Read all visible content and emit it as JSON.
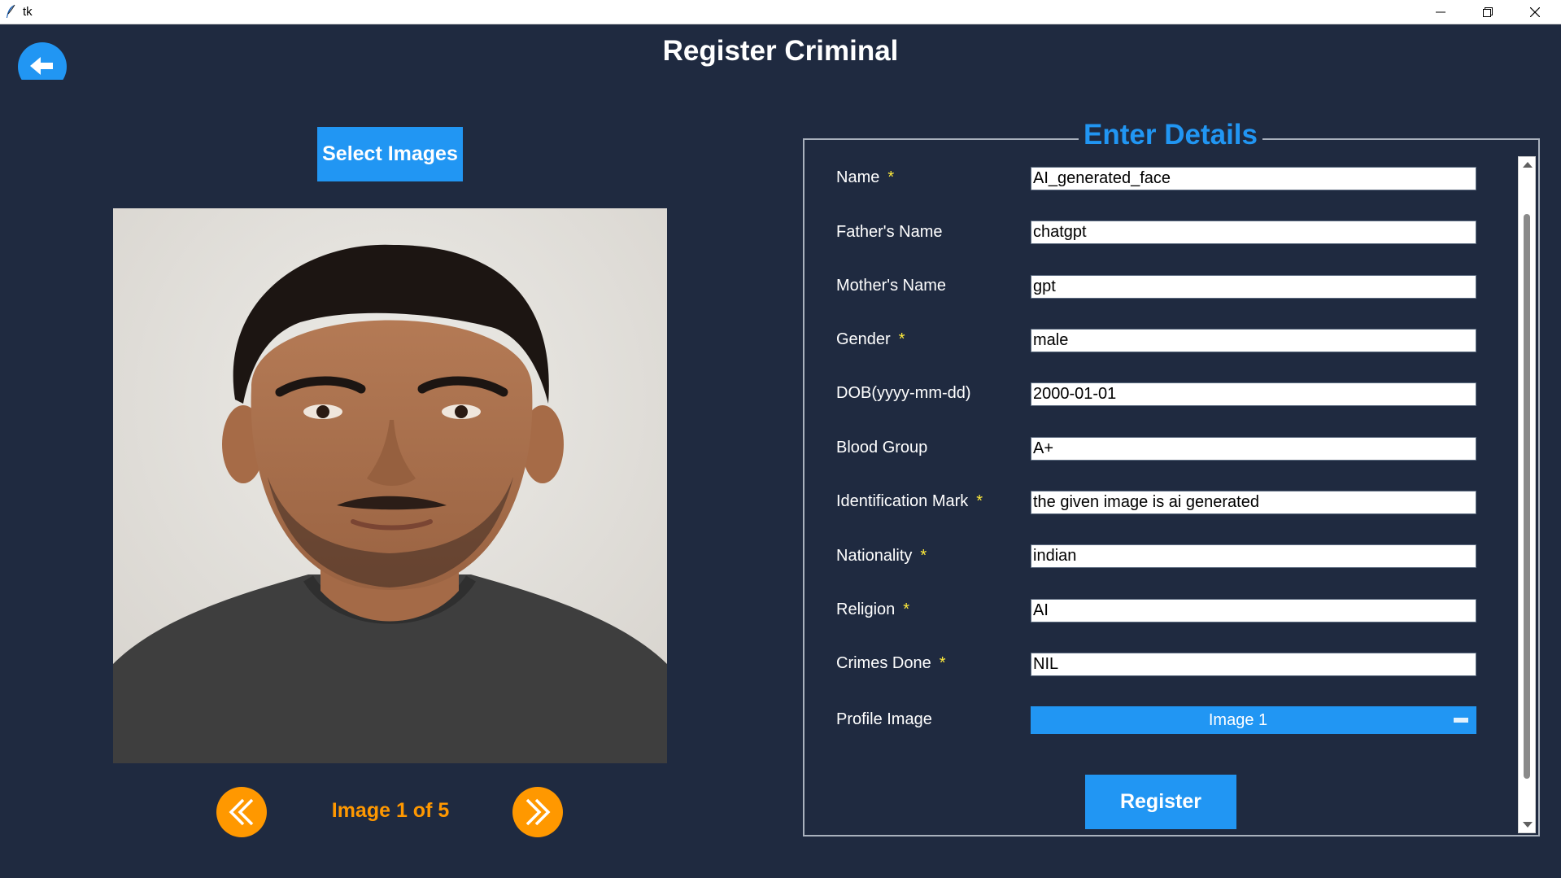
{
  "window": {
    "title": "tk",
    "min_icon": "minimize-icon",
    "max_icon": "restore-icon",
    "close_icon": "close-icon"
  },
  "page": {
    "title": "Register Criminal",
    "back_icon": "arrow-left-icon"
  },
  "left": {
    "select_button": "Select Images",
    "photo_icon": "person-photo",
    "counter": "Image 1 of 5",
    "prev_icon": "double-chevron-left-icon",
    "next_icon": "double-chevron-right-icon"
  },
  "form": {
    "legend": "Enter Details",
    "fields": [
      {
        "label": "Name",
        "required": "*",
        "value": "AI_generated_face"
      },
      {
        "label": "Father's Name",
        "value": "chatgpt"
      },
      {
        "label": "Mother's Name",
        "value": "gpt"
      },
      {
        "label": "Gender",
        "required": "*",
        "value": "male"
      },
      {
        "label": "DOB(yyyy-mm-dd)",
        "value": "2000-01-01"
      },
      {
        "label": "Blood Group",
        "value": "A+"
      },
      {
        "label": "Identification Mark",
        "required": "*",
        "value": "the given image is ai generated"
      },
      {
        "label": "Nationality",
        "required": "*",
        "value": "indian"
      },
      {
        "label": "Religion",
        "required": "*",
        "value": "AI"
      },
      {
        "label": "Crimes Done",
        "required": "*",
        "value": "NIL"
      }
    ],
    "profile_label": "Profile Image",
    "profile_value": "Image 1",
    "register_button": "Register"
  },
  "colors": {
    "background": "#1f2a40",
    "accent": "#2196f3",
    "orange": "#ff9800",
    "required": "#ffeb3b"
  }
}
